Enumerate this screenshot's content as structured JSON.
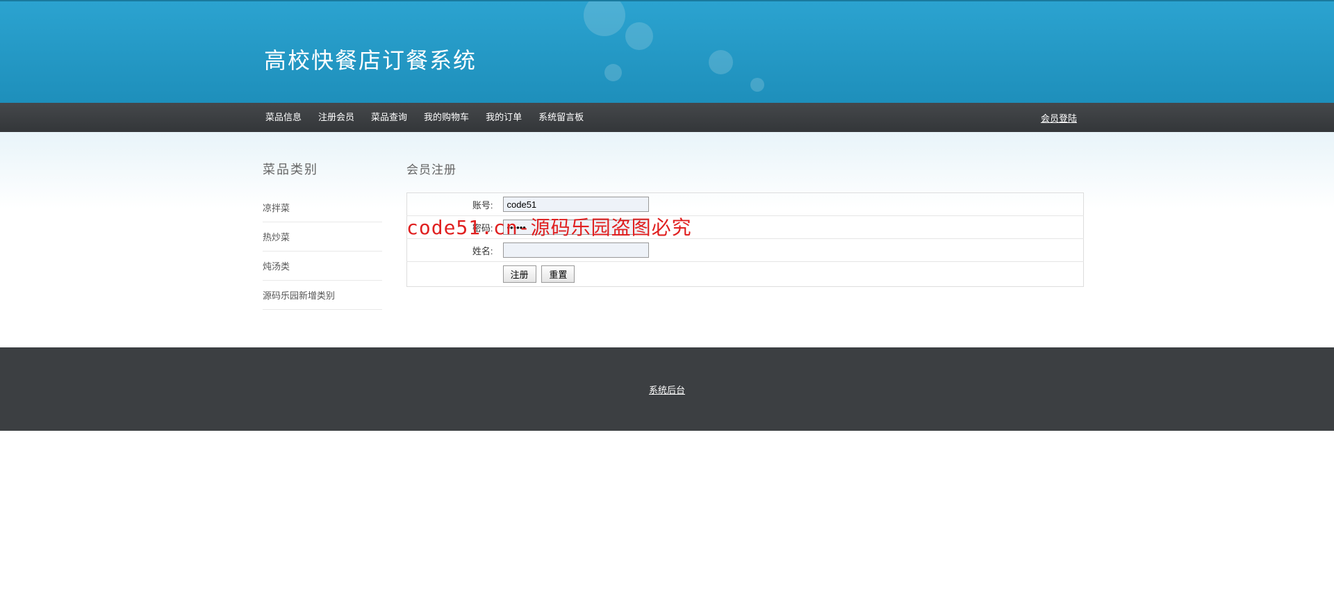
{
  "header": {
    "title": "高校快餐店订餐系统"
  },
  "nav": {
    "items": [
      "菜品信息",
      "注册会员",
      "菜品查询",
      "我的购物车",
      "我的订单",
      "系统留言板"
    ],
    "login": "会员登陆"
  },
  "sidebar": {
    "title": "菜品类别",
    "items": [
      "凉拌菜",
      "热炒菜",
      "炖汤类",
      "源码乐园新增类别"
    ]
  },
  "main": {
    "title": "会员注册",
    "labels": {
      "username": "账号:",
      "password": "密码:",
      "realname": "姓名:"
    },
    "values": {
      "username": "code51",
      "password": "••••••",
      "realname": ""
    },
    "buttons": {
      "submit": "注册",
      "reset": "重置"
    }
  },
  "watermark": "code51.cn-源码乐园盗图必究",
  "footer": {
    "link": "系统后台"
  }
}
